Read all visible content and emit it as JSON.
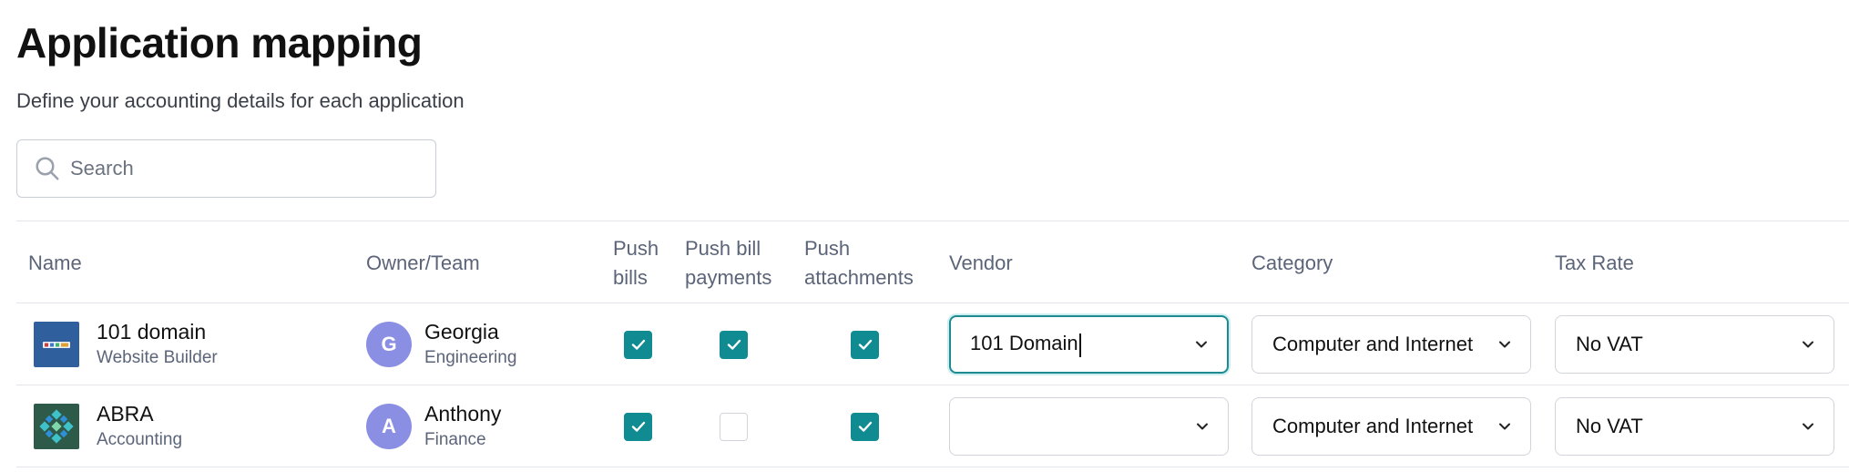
{
  "header": {
    "title": "Application mapping",
    "subtitle": "Define your accounting details for each application"
  },
  "search": {
    "placeholder": "Search",
    "value": ""
  },
  "table": {
    "columns": {
      "name": "Name",
      "owner": "Owner/Team",
      "push_bills": [
        "Push",
        "bills"
      ],
      "push_bill_payments": [
        "Push bill",
        "payments"
      ],
      "push_attachments": [
        "Push",
        "attachments"
      ],
      "vendor": "Vendor",
      "category": "Category",
      "tax_rate": "Tax Rate"
    },
    "rows": [
      {
        "app_name": "101 domain",
        "app_type": "Website Builder",
        "logo_icon": "101domain-logo",
        "owner_initial": "G",
        "owner_name": "Georgia",
        "owner_team": "Engineering",
        "push_bills": true,
        "push_bill_payments": true,
        "push_attachments": true,
        "vendor": "101 Domain",
        "category": "Computer and Internet",
        "tax_rate": "No VAT"
      },
      {
        "app_name": "ABRA",
        "app_type": "Accounting",
        "logo_icon": "abra-logo",
        "owner_initial": "A",
        "owner_name": "Anthony",
        "owner_team": "Finance",
        "push_bills": true,
        "push_bill_payments": false,
        "push_attachments": true,
        "vendor": "",
        "category": "Computer and Internet",
        "tax_rate": "No VAT"
      }
    ]
  },
  "colors": {
    "accent": "#0f8b91",
    "avatar": "#8b8fe3",
    "muted_text": "#5b6478",
    "border": "#e3e6ea"
  }
}
